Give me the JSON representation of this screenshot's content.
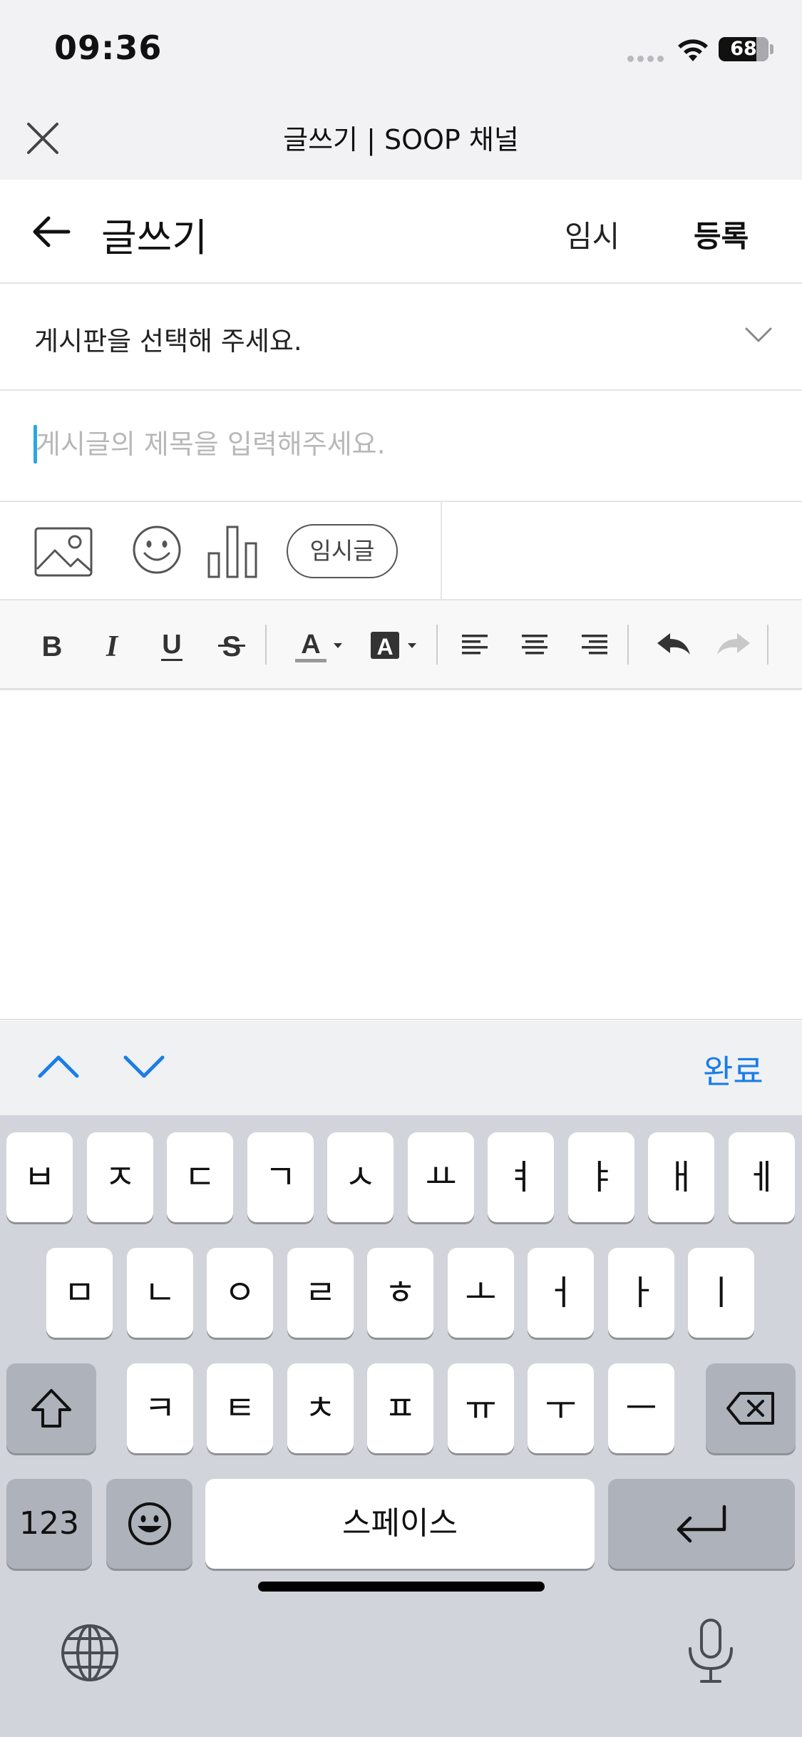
{
  "status": {
    "time": "09:36",
    "battery": "68"
  },
  "browser": {
    "title": "글쓰기 | SOOP 채널"
  },
  "appbar": {
    "title": "글쓰기",
    "temp_label": "임시",
    "submit_label": "등록"
  },
  "board": {
    "placeholder": "게시판을 선택해 주세요."
  },
  "title_input": {
    "placeholder": "게시글의 제목을 입력해주세요.",
    "value": ""
  },
  "attach": {
    "draft_label": "임시글"
  },
  "accessory": {
    "done_label": "완료"
  },
  "keyboard": {
    "row1": [
      "ㅂ",
      "ㅈ",
      "ㄷ",
      "ㄱ",
      "ㅅ",
      "ㅛ",
      "ㅕ",
      "ㅑ",
      "ㅐ",
      "ㅔ"
    ],
    "row2": [
      "ㅁ",
      "ㄴ",
      "ㅇ",
      "ㄹ",
      "ㅎ",
      "ㅗ",
      "ㅓ",
      "ㅏ",
      "ㅣ"
    ],
    "row3": [
      "ㅋ",
      "ㅌ",
      "ㅊ",
      "ㅍ",
      "ㅠ",
      "ㅜ",
      "ㅡ"
    ],
    "numbers_label": "123",
    "space_label": "스페이스"
  },
  "colors": {
    "accent": "#1a7de8",
    "caret": "#2aa7e0",
    "keyboard_bg": "#d1d4da"
  }
}
